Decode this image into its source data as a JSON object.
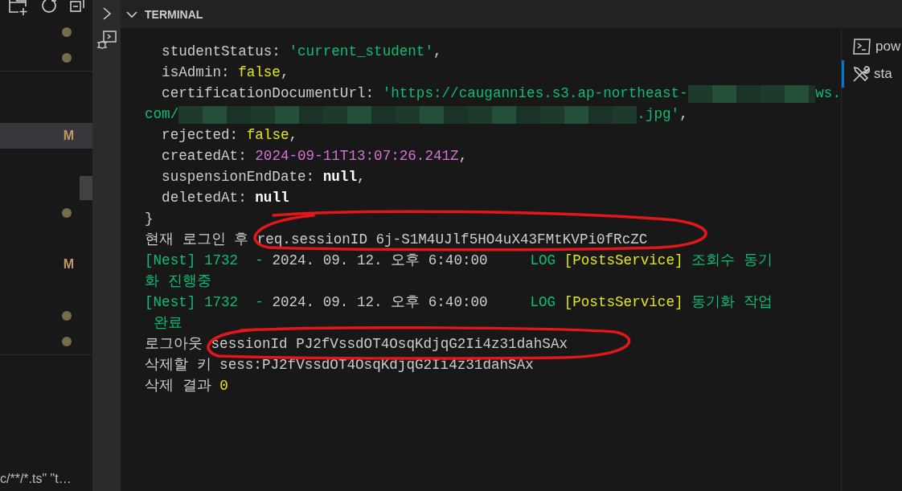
{
  "sidebar": {
    "sections": [
      {
        "items": [
          {
            "kind": "dot",
            "selected": false
          },
          {
            "kind": "dot",
            "selected": false
          }
        ]
      },
      {
        "items": [
          {
            "kind": "blank",
            "selected": false
          },
          {
            "kind": "blank",
            "selected": false
          },
          {
            "kind": "badge",
            "badge": "M",
            "selected": true
          },
          {
            "kind": "blank",
            "selected": false
          },
          {
            "kind": "blank",
            "selected": false
          },
          {
            "kind": "dot",
            "selected": false
          },
          {
            "kind": "blank",
            "selected": false
          },
          {
            "kind": "badge",
            "badge": "M",
            "selected": false
          },
          {
            "kind": "blank",
            "selected": false
          },
          {
            "kind": "dot",
            "selected": false
          },
          {
            "kind": "dot",
            "selected": false
          }
        ]
      }
    ],
    "footer": "c/**/*.ts\" \"t…"
  },
  "panel": {
    "title": "TERMINAL",
    "expanded": true
  },
  "terminal": {
    "lines": [
      {
        "segments": [
          {
            "text": "  studentStatus: ",
            "kind": "plain"
          },
          {
            "text": "'current_student'",
            "kind": "string"
          },
          {
            "text": ",",
            "kind": "plain"
          }
        ]
      },
      {
        "segments": [
          {
            "text": "  isAdmin: ",
            "kind": "plain"
          },
          {
            "text": "false",
            "kind": "boolean"
          },
          {
            "text": ",",
            "kind": "plain"
          }
        ]
      },
      {
        "wrapped": true,
        "segments": [
          {
            "text": "  certificationDocumentUrl: ",
            "kind": "plain"
          },
          {
            "text": "'https://caugannies.s3.ap-northeast-",
            "kind": "string"
          },
          {
            "kind": "redacted"
          },
          {
            "text": "ws.",
            "kind": "string"
          }
        ]
      },
      {
        "segments": [
          {
            "text": "com/",
            "kind": "string"
          },
          {
            "kind": "redacted"
          },
          {
            "text": ".jpg'",
            "kind": "string"
          },
          {
            "text": ",",
            "kind": "plain"
          }
        ]
      },
      {
        "segments": [
          {
            "text": "  rejected: ",
            "kind": "plain"
          },
          {
            "text": "false",
            "kind": "boolean"
          },
          {
            "text": ",",
            "kind": "plain"
          }
        ]
      },
      {
        "segments": [
          {
            "text": "  createdAt: ",
            "kind": "plain"
          },
          {
            "text": "2024-09-11T13:07:26.241Z",
            "kind": "date"
          },
          {
            "text": ",",
            "kind": "plain"
          }
        ]
      },
      {
        "segments": [
          {
            "text": "  suspensionEndDate: ",
            "kind": "plain"
          },
          {
            "text": "null",
            "kind": "null"
          },
          {
            "text": ",",
            "kind": "plain"
          }
        ]
      },
      {
        "segments": [
          {
            "text": "  deletedAt: ",
            "kind": "plain"
          },
          {
            "text": "null",
            "kind": "null"
          }
        ]
      },
      {
        "segments": [
          {
            "text": "}",
            "kind": "plain"
          }
        ]
      },
      {
        "segments": [
          {
            "text": "현재 로그인 후 ",
            "kind": "plain"
          },
          {
            "text": "req.sessionID 6j-S1M4UJlf5HO4uX43FMtKVPi0fRcZC",
            "kind": "plain"
          }
        ]
      },
      {
        "segments": [
          {
            "text": "[Nest] 1732  - ",
            "kind": "nest"
          },
          {
            "text": "2024. 09. 12. 오후 6:40:00     ",
            "kind": "plain"
          },
          {
            "text": "LOG ",
            "kind": "nest"
          },
          {
            "text": "[PostsService] ",
            "kind": "context"
          },
          {
            "text": "조회수 동기",
            "kind": "nest"
          }
        ]
      },
      {
        "segments": [
          {
            "text": "화 진행중",
            "kind": "nest"
          }
        ]
      },
      {
        "segments": [
          {
            "text": "[Nest] 1732  - ",
            "kind": "nest"
          },
          {
            "text": "2024. 09. 12. 오후 6:40:00     ",
            "kind": "plain"
          },
          {
            "text": "LOG ",
            "kind": "nest"
          },
          {
            "text": "[PostsService] ",
            "kind": "context"
          },
          {
            "text": "동기화 작업",
            "kind": "nest"
          }
        ]
      },
      {
        "segments": [
          {
            "text": " 완료",
            "kind": "nest"
          }
        ]
      },
      {
        "segments": [
          {
            "text": "로그아웃 ",
            "kind": "plain"
          },
          {
            "text": "sessionId PJ2fVssdOT4OsqKdjqG2Ii4z31dahSAx",
            "kind": "plain"
          }
        ]
      },
      {
        "segments": [
          {
            "text": "삭제할 키 sess:PJ2fVssdOT4OsqKdjqG2Ii4z31dahSAx",
            "kind": "plain"
          }
        ]
      },
      {
        "segments": [
          {
            "text": "삭제 결과 ",
            "kind": "plain"
          },
          {
            "text": "0",
            "kind": "boolean"
          }
        ]
      }
    ]
  },
  "terminal_list": [
    {
      "label": "pow",
      "kind": "shell",
      "selected": false
    },
    {
      "label": "sta",
      "kind": "task",
      "selected": true
    }
  ]
}
